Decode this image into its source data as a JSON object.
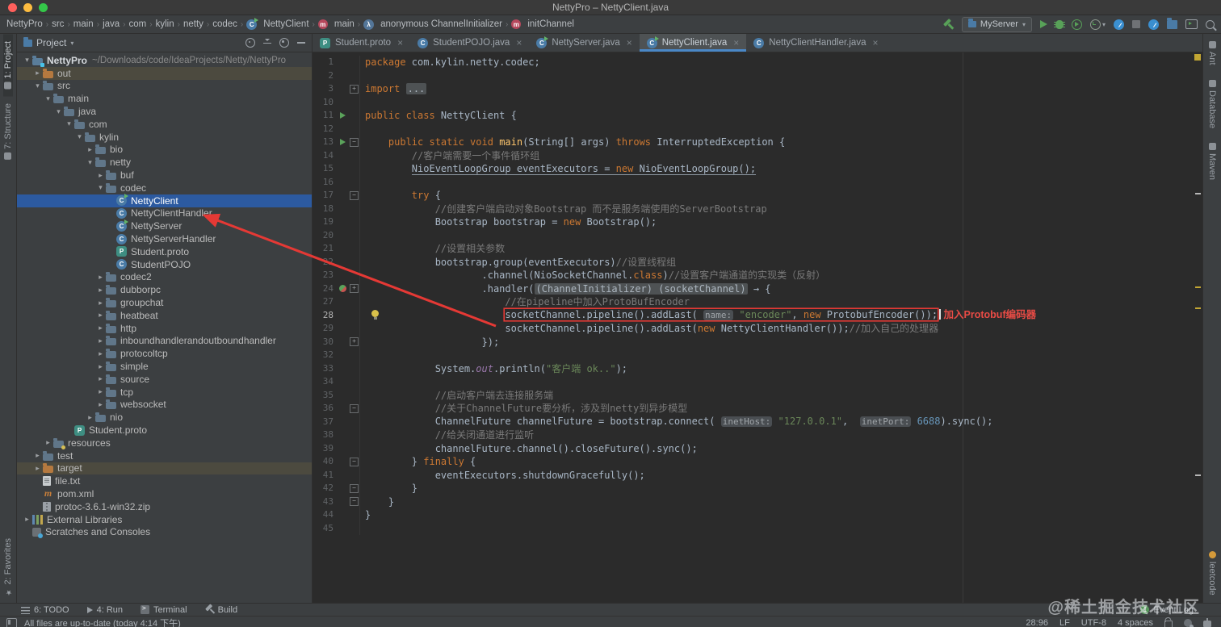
{
  "titlebar": {
    "title": "NettyPro – NettyClient.java"
  },
  "breadcrumb": {
    "separator": "›",
    "items": [
      {
        "label": "NettyPro"
      },
      {
        "label": "src"
      },
      {
        "label": "main"
      },
      {
        "label": "java"
      },
      {
        "label": "com"
      },
      {
        "label": "kylin"
      },
      {
        "label": "netty"
      },
      {
        "label": "codec"
      },
      {
        "label": "NettyClient",
        "icon": "class-run"
      },
      {
        "label": "main",
        "icon": "method"
      },
      {
        "label": "anonymous ChannelInitializer",
        "icon": "anonymous-class"
      },
      {
        "label": "initChannel",
        "icon": "method"
      }
    ]
  },
  "toolbar": {
    "run_config": "MyServer"
  },
  "project_panel": {
    "title": "Project",
    "tree": [
      {
        "label": "NettyPro",
        "level": 0,
        "arrow": "down",
        "icon": "project",
        "bold": true,
        "path": "~/Downloads/code/IdeaProjects/Netty/NettyPro"
      },
      {
        "label": "out",
        "level": 1,
        "arrow": "right",
        "icon": "folder-orange",
        "olive": true
      },
      {
        "label": "src",
        "level": 1,
        "arrow": "down",
        "icon": "folder-blue"
      },
      {
        "label": "main",
        "level": 2,
        "arrow": "down",
        "icon": "folder-blue"
      },
      {
        "label": "java",
        "level": 3,
        "arrow": "down",
        "icon": "folder-blue"
      },
      {
        "label": "com",
        "level": 4,
        "arrow": "down",
        "icon": "package"
      },
      {
        "label": "kylin",
        "level": 5,
        "arrow": "down",
        "icon": "package"
      },
      {
        "label": "bio",
        "level": 6,
        "arrow": "right",
        "icon": "package"
      },
      {
        "label": "netty",
        "level": 6,
        "arrow": "down",
        "icon": "package"
      },
      {
        "label": "buf",
        "level": 7,
        "arrow": "right",
        "icon": "package"
      },
      {
        "label": "codec",
        "level": 7,
        "arrow": "down",
        "icon": "package"
      },
      {
        "label": "NettyClient",
        "level": 8,
        "arrow": "",
        "icon": "class-run",
        "sel": true
      },
      {
        "label": "NettyClientHandler",
        "level": 8,
        "arrow": "",
        "icon": "class"
      },
      {
        "label": "NettyServer",
        "level": 8,
        "arrow": "",
        "icon": "class-run"
      },
      {
        "label": "NettyServerHandler",
        "level": 8,
        "arrow": "",
        "icon": "class"
      },
      {
        "label": "Student.proto",
        "level": 8,
        "arrow": "",
        "icon": "proto"
      },
      {
        "label": "StudentPOJO",
        "level": 8,
        "arrow": "",
        "icon": "class"
      },
      {
        "label": "codec2",
        "level": 7,
        "arrow": "right",
        "icon": "package"
      },
      {
        "label": "dubborpc",
        "level": 7,
        "arrow": "right",
        "icon": "package"
      },
      {
        "label": "groupchat",
        "level": 7,
        "arrow": "right",
        "icon": "package"
      },
      {
        "label": "heatbeat",
        "level": 7,
        "arrow": "right",
        "icon": "package"
      },
      {
        "label": "http",
        "level": 7,
        "arrow": "right",
        "icon": "package"
      },
      {
        "label": "inboundhandlerandoutboundhandler",
        "level": 7,
        "arrow": "right",
        "icon": "package"
      },
      {
        "label": "protocoltcp",
        "level": 7,
        "arrow": "right",
        "icon": "package"
      },
      {
        "label": "simple",
        "level": 7,
        "arrow": "right",
        "icon": "package"
      },
      {
        "label": "source",
        "level": 7,
        "arrow": "right",
        "icon": "package"
      },
      {
        "label": "tcp",
        "level": 7,
        "arrow": "right",
        "icon": "package"
      },
      {
        "label": "websocket",
        "level": 7,
        "arrow": "right",
        "icon": "package"
      },
      {
        "label": "nio",
        "level": 6,
        "arrow": "right",
        "icon": "package"
      },
      {
        "label": "Student.proto",
        "level": 4,
        "arrow": "",
        "icon": "proto"
      },
      {
        "label": "resources",
        "level": 2,
        "arrow": "right",
        "icon": "folder-resources"
      },
      {
        "label": "test",
        "level": 1,
        "arrow": "right",
        "icon": "folder-blue"
      },
      {
        "label": "target",
        "level": 1,
        "arrow": "right",
        "icon": "folder-orange",
        "olive": true
      },
      {
        "label": "file.txt",
        "level": 1,
        "arrow": "",
        "icon": "file-text"
      },
      {
        "label": "pom.xml",
        "level": 1,
        "arrow": "",
        "icon": "maven"
      },
      {
        "label": "protoc-3.6.1-win32.zip",
        "level": 1,
        "arrow": "",
        "icon": "zip"
      },
      {
        "label": "External Libraries",
        "level": 0,
        "arrow": "right",
        "icon": "libraries"
      },
      {
        "label": "Scratches and Consoles",
        "level": 0,
        "arrow": "",
        "icon": "scratches"
      }
    ]
  },
  "tabs": {
    "items": [
      {
        "label": "Student.proto",
        "icon": "proto"
      },
      {
        "label": "StudentPOJO.java",
        "icon": "class"
      },
      {
        "label": "NettyServer.java",
        "icon": "class-run"
      },
      {
        "label": "NettyClient.java",
        "icon": "class-run",
        "active": true
      },
      {
        "label": "NettyClientHandler.java",
        "icon": "class"
      }
    ],
    "close_glyph": "×"
  },
  "editor": {
    "current_line": 28,
    "lines": [
      {
        "n": 1,
        "seg": [
          [
            "package",
            "kw"
          ],
          [
            " com.kylin.netty.codec;",
            "txt"
          ]
        ]
      },
      {
        "n": 2,
        "seg": []
      },
      {
        "n": 3,
        "fold": "plus",
        "seg": [
          [
            "import",
            "kw"
          ],
          [
            " ",
            "txt"
          ],
          [
            "...",
            "foldpill"
          ]
        ]
      },
      {
        "n": 10,
        "seg": []
      },
      {
        "n": 11,
        "gutter": "run",
        "seg": [
          [
            "public class",
            "kw"
          ],
          [
            " NettyClient {",
            "txt"
          ]
        ]
      },
      {
        "n": 12,
        "seg": []
      },
      {
        "n": 13,
        "gutter": "run",
        "fold": "minus",
        "seg": [
          [
            "    ",
            "txt"
          ],
          [
            "public static void",
            "kw"
          ],
          [
            " ",
            "txt"
          ],
          [
            "main",
            "mth"
          ],
          [
            "(String[] args) ",
            "txt"
          ],
          [
            "throws",
            "kw"
          ],
          [
            " InterruptedException {",
            "txt"
          ]
        ]
      },
      {
        "n": 14,
        "seg": [
          [
            "        //客户端需要一个事件循环组",
            "cmt"
          ]
        ]
      },
      {
        "n": 15,
        "seg": [
          [
            "        ",
            "txt"
          ],
          [
            "NioEventLoopGroup eventExecutors = ",
            "txt u"
          ],
          [
            "new",
            "kw u"
          ],
          [
            " NioEventLoopGroup();",
            "txt u"
          ]
        ]
      },
      {
        "n": 16,
        "seg": []
      },
      {
        "n": 17,
        "fold": "minus",
        "seg": [
          [
            "        ",
            "txt"
          ],
          [
            "try",
            "kw"
          ],
          [
            " {",
            "txt"
          ]
        ]
      },
      {
        "n": 18,
        "seg": [
          [
            "            //创建客户端启动对象Bootstrap 而不是服务端使用的ServerBootstrap",
            "cmt"
          ]
        ]
      },
      {
        "n": 19,
        "seg": [
          [
            "            Bootstrap bootstrap = ",
            "txt"
          ],
          [
            "new",
            "kw"
          ],
          [
            " Bootstrap();",
            "txt"
          ]
        ]
      },
      {
        "n": 20,
        "seg": []
      },
      {
        "n": 21,
        "seg": [
          [
            "            //设置相关参数",
            "cmt"
          ]
        ]
      },
      {
        "n": 22,
        "seg": [
          [
            "            bootstrap.group(eventExecutors)",
            "txt"
          ],
          [
            "//设置线程组",
            "cmt"
          ]
        ]
      },
      {
        "n": 23,
        "seg": [
          [
            "                    .channel(NioSocketChannel.",
            "txt"
          ],
          [
            "class",
            "kw"
          ],
          [
            ")",
            "txt"
          ],
          [
            "//设置客户端通道的实现类（反射）",
            "cmt"
          ]
        ]
      },
      {
        "n": 24,
        "gutter": "lambda",
        "fold": "plus",
        "seg": [
          [
            "                    .handler(",
            "txt"
          ],
          [
            "(ChannelInitializer) (socketChannel)",
            "foldpill"
          ],
          [
            " → {",
            "txt"
          ]
        ]
      },
      {
        "n": 27,
        "seg": [
          [
            "                        //在pipeline中加入ProtoBufEncoder",
            "cmt"
          ]
        ]
      },
      {
        "n": 28,
        "bulb": true,
        "box": {
          "pre": "                        ",
          "inside": [
            [
              "socketChannel.pipeline().addLast( ",
              "txt"
            ],
            [
              "name:",
              "hint"
            ],
            [
              " ",
              "txt"
            ],
            [
              "\"encoder\"",
              "str"
            ],
            [
              ", ",
              "txt"
            ],
            [
              "new",
              "kw"
            ],
            [
              " ProtobufEncoder());",
              "txt"
            ]
          ]
        }
      },
      {
        "n": 29,
        "seg": [
          [
            "                        socketChannel.pipeline().addLast(",
            "txt"
          ],
          [
            "new",
            "kw"
          ],
          [
            " NettyClientHandler());",
            "txt"
          ],
          [
            "//加入自己的处理器",
            "cmt"
          ]
        ]
      },
      {
        "n": 30,
        "fold": "plus",
        "seg": [
          [
            "                    });",
            "txt"
          ]
        ]
      },
      {
        "n": 32,
        "seg": []
      },
      {
        "n": 33,
        "seg": [
          [
            "            System.",
            "txt"
          ],
          [
            "out",
            "fld"
          ],
          [
            ".println(",
            "txt"
          ],
          [
            "\"客户端 ok..\"",
            "str"
          ],
          [
            ");",
            "txt"
          ]
        ]
      },
      {
        "n": 34,
        "seg": []
      },
      {
        "n": 35,
        "seg": [
          [
            "            //启动客户端去连接服务端",
            "cmt"
          ]
        ]
      },
      {
        "n": 36,
        "fold": "minus",
        "seg": [
          [
            "            //关于ChannelFuture要分析，涉及到netty到异步模型",
            "cmt"
          ]
        ]
      },
      {
        "n": 37,
        "seg": [
          [
            "            ChannelFuture channelFuture = bootstrap.connect( ",
            "txt"
          ],
          [
            "inetHost:",
            "hint"
          ],
          [
            " ",
            "txt"
          ],
          [
            "\"127.0.0.1\"",
            "str"
          ],
          [
            ",  ",
            "txt"
          ],
          [
            "inetPort:",
            "hint"
          ],
          [
            " ",
            "txt"
          ],
          [
            "6688",
            "num"
          ],
          [
            ").sync();",
            "txt"
          ]
        ]
      },
      {
        "n": 38,
        "seg": [
          [
            "            //给关闭通道进行监听",
            "cmt"
          ]
        ]
      },
      {
        "n": 39,
        "seg": [
          [
            "            channelFuture.channel().closeFuture().sync();",
            "txt"
          ]
        ]
      },
      {
        "n": 40,
        "fold": "minus",
        "seg": [
          [
            "        } ",
            "txt"
          ],
          [
            "finally",
            "kw"
          ],
          [
            " {",
            "txt"
          ]
        ]
      },
      {
        "n": 41,
        "seg": [
          [
            "            eventExecutors.shutdownGracefully();",
            "txt"
          ]
        ]
      },
      {
        "n": 42,
        "fold": "minus",
        "seg": [
          [
            "        }",
            "txt"
          ]
        ]
      },
      {
        "n": 43,
        "fold": "minus",
        "seg": [
          [
            "    }",
            "txt"
          ]
        ]
      },
      {
        "n": 44,
        "seg": [
          [
            "}",
            "txt"
          ]
        ]
      },
      {
        "n": 45,
        "seg": []
      }
    ]
  },
  "annotations": {
    "line28_note": "加入Protobuf编码器"
  },
  "stripes": {
    "left_top": [
      "1: Project",
      "7: Structure"
    ],
    "left_bottom": [
      "2: Favorites"
    ],
    "right_top": [
      "Ant",
      "Database",
      "Maven"
    ],
    "right_bottom": [
      "leetcode"
    ]
  },
  "bottombar": {
    "items": [
      {
        "label": "6: TODO",
        "icon": "todo"
      },
      {
        "label": "4: Run",
        "icon": "run"
      },
      {
        "label": "Terminal",
        "icon": "terminal"
      },
      {
        "label": "Build",
        "icon": "build"
      }
    ],
    "event_log": {
      "label": "Event Log",
      "badge": "1"
    }
  },
  "statusbar": {
    "message": "All files are up-to-date (today 4:14 下午)",
    "position": "28:96",
    "line_sep": "LF",
    "encoding": "UTF-8",
    "indent": "4 spaces"
  },
  "watermark": "@稀土掘金技术社区",
  "colors": {
    "accent_blue": "#4a88c7",
    "selection": "#2c5aa0",
    "error_red": "#e53935",
    "run_green": "#5ba35b",
    "warn_yellow": "#c2a633"
  }
}
